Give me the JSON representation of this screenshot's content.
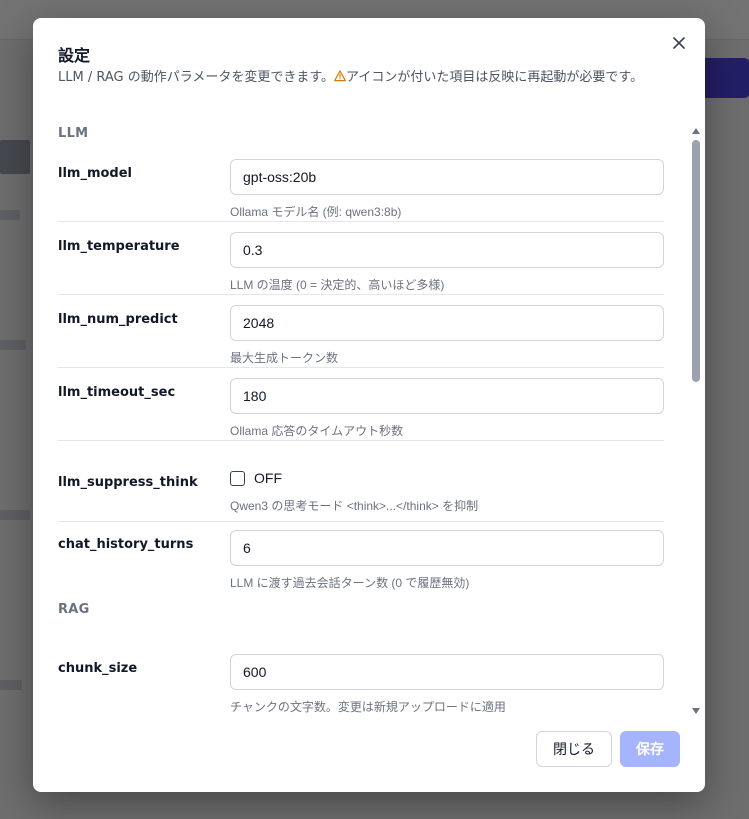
{
  "modal": {
    "title": "設定",
    "description_before": "LLM / RAG の動作パラメータを変更できます。",
    "warning_icon": "warning-triangle-icon",
    "description_after": "アイコンが付いた項目は反映に再起動が必要です。",
    "close_icon": "close-icon"
  },
  "sections": {
    "llm": "LLM",
    "rag": "RAG"
  },
  "fields": {
    "llm_model": {
      "label": "llm_model",
      "value": "gpt-oss:20b",
      "hint": "Ollama モデル名 (例: qwen3:8b)"
    },
    "llm_temperature": {
      "label": "llm_temperature",
      "value": "0.3",
      "hint": "LLM の温度 (0 = 決定的、高いほど多様)"
    },
    "llm_num_predict": {
      "label": "llm_num_predict",
      "value": "2048",
      "hint": "最大生成トークン数"
    },
    "llm_timeout_sec": {
      "label": "llm_timeout_sec",
      "value": "180",
      "hint": "Ollama 応答のタイムアウト秒数"
    },
    "llm_suppress_think": {
      "label": "llm_suppress_think",
      "checked": false,
      "checkbox_text": "OFF",
      "hint": "Qwen3 の思考モード <think>...</think> を抑制"
    },
    "chat_history_turns": {
      "label": "chat_history_turns",
      "value": "6",
      "hint": "LLM に渡す過去会話ターン数 (0 で履歴無効)"
    },
    "chunk_size": {
      "label": "chunk_size",
      "value": "600",
      "hint": "チャンクの文字数。変更は新規アップロードに適用"
    }
  },
  "footer": {
    "close_label": "閉じる",
    "save_label": "保存"
  },
  "colors": {
    "accent": "#a5b4fc",
    "warning": "#d97706",
    "section_label": "#6b7280"
  }
}
